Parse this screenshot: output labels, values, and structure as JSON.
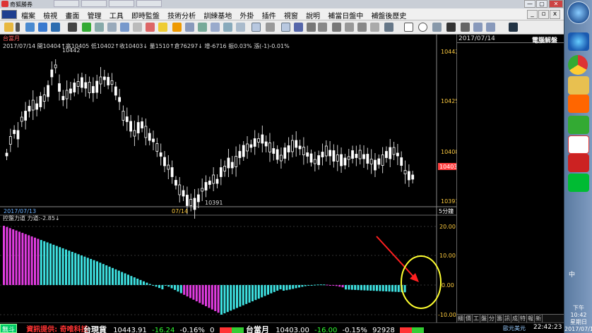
{
  "window": {
    "title": "奇狐勝券",
    "minimize": "—",
    "maximize": "▢",
    "close": "✕"
  },
  "menu": {
    "items": [
      "檔案",
      "檢視",
      "畫面",
      "管理",
      "工具",
      "即時監盤",
      "技術分析",
      "訓練基地",
      "外掛",
      "插件",
      "視窗",
      "說明",
      "補當日盤中",
      "補盤後歷史"
    ]
  },
  "chart": {
    "symbol_label": "台當月",
    "info_line": "2017/07/14 開10404↑高10405 低10402↑收10403↓ 量1510↑倉76297↓ 增-6716 振0.03% 漲(-1)-0.01%",
    "price_labels": [
      "10442",
      "10425",
      "10408",
      "10403",
      "10391"
    ],
    "annot_high": "10442",
    "annot_low": "10391",
    "date_left": "2017/07/13",
    "date_mid": "07/14",
    "interval": "5分鐘",
    "indicator_label": "控盤力道 力道:-2.85↓",
    "indicator_levels": [
      "20.00",
      "10.00",
      "0.00",
      "-10.00"
    ]
  },
  "colors": {
    "up": "#ffffff",
    "down": "#ffffff",
    "pos_bar": "#e03ce0",
    "neg_bar": "#3ee0e0",
    "arrow": "#ff2020",
    "circle": "#ffff30",
    "current_price_bg": "#ff4040"
  },
  "right_panel": {
    "date": "2017/07/14",
    "title": "電腦解盤",
    "tabs": [
      "細",
      "價",
      "工",
      "盤",
      "分",
      "籌",
      "訊",
      "成",
      "特",
      "報",
      "新"
    ]
  },
  "status": {
    "provider_btn": "無斗",
    "provider_text": "資訊提供: 奇唯科技",
    "spot": {
      "name": "台現貨",
      "price": "10443.91",
      "change": "-16.24",
      "percent": "-0.16%",
      "volume": "0"
    },
    "futures": {
      "name": "台當月",
      "price": "10403.00",
      "change": "-16.00",
      "percent": "-0.15%",
      "volume": "92928"
    },
    "news": "歐元美元",
    "time": "22:42:23"
  },
  "taskbar": {
    "tray_text": "中",
    "clock_time": "下午 10:42",
    "clock_day": "星期日",
    "clock_date": "2017/07/16"
  }
}
